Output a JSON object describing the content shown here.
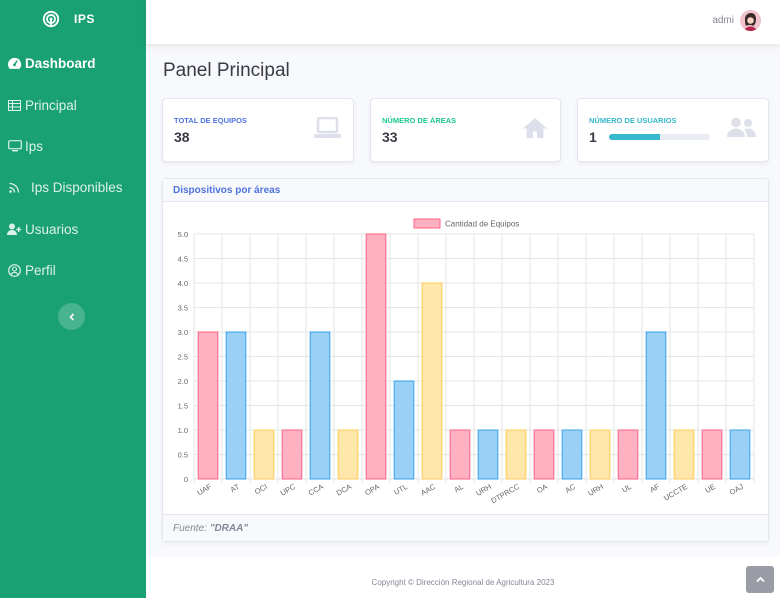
{
  "brand": {
    "name": "IPS"
  },
  "sidebar": {
    "items": [
      {
        "label": "Dashboard",
        "icon": "tachometer-icon",
        "active": true
      },
      {
        "label": "Principal",
        "icon": "table-icon"
      },
      {
        "label": "Ips",
        "icon": "desktop-icon"
      },
      {
        "label": "Ips Disponibles",
        "icon": "rss-icon"
      },
      {
        "label": "Usuarios",
        "icon": "user-plus-icon"
      },
      {
        "label": "Perfil",
        "icon": "user-circle-icon"
      }
    ],
    "toggle_icon": "chevron-left-icon"
  },
  "topbar": {
    "user_name": "admi"
  },
  "page": {
    "title": "Panel Principal"
  },
  "stats": [
    {
      "label": "TOTAL DE EQUIPOS",
      "value": "38",
      "color": "#4e73df",
      "icon": "laptop-icon"
    },
    {
      "label": "NÚMERO DE ÁREAS",
      "value": "33",
      "color": "#1cc88a",
      "icon": "home-icon"
    },
    {
      "label": "NÚMERO DE USUARIOS",
      "value": "1",
      "color": "#36b9cc",
      "icon": "users-icon",
      "progress": 0.5
    }
  ],
  "chart_card": {
    "title": "Dispositivos por áreas",
    "footer_prefix": "Fuente: ",
    "footer_source": "\"DRAA\""
  },
  "chart_data": {
    "type": "bar",
    "categories": [
      "UAF",
      "AT",
      "OCI",
      "UPC",
      "CCA",
      "DCA",
      "OPA",
      "UTL",
      "AAC",
      "AL",
      "URH",
      "DTPRCC",
      "OA",
      "AC",
      "URH",
      "UL",
      "AF",
      "UCCTE",
      "UE",
      "OAJ"
    ],
    "series": [
      {
        "name": "Cantidad de Equipos",
        "values": [
          3,
          3,
          1,
          1,
          3,
          1,
          5,
          2,
          4,
          1,
          1,
          1,
          1,
          1,
          1,
          1,
          3,
          1,
          1,
          1
        ]
      }
    ],
    "ylim": [
      0,
      5
    ],
    "yticks": [
      "0",
      "0.5",
      "1.0",
      "1.5",
      "2.0",
      "2.5",
      "3.0",
      "3.5",
      "4.0",
      "4.5",
      "5.0"
    ],
    "legend_position": "top",
    "grid": true,
    "colors": {
      "fills": [
        "#ffb1c1",
        "#9ad0f5",
        "#ffe6aa"
      ],
      "strokes": [
        "#ff6384",
        "#36a2eb",
        "#ffcd56"
      ]
    }
  },
  "footer": {
    "copyright": "Copyright © Dirección Regional de Agricultura 2023"
  },
  "scroll_top_icon": "chevron-up-icon"
}
